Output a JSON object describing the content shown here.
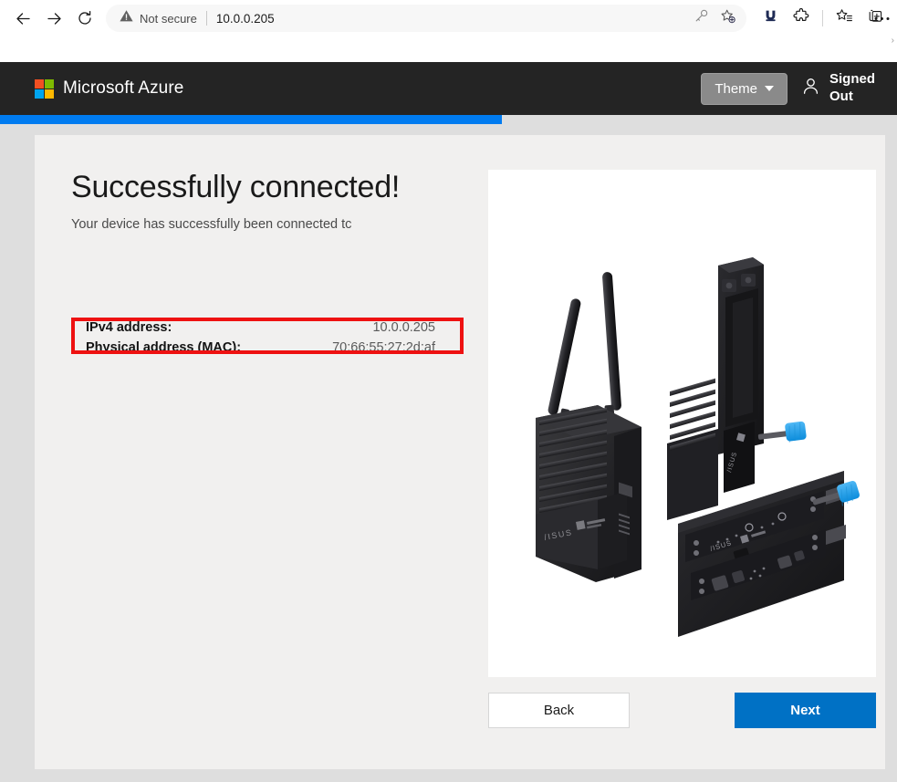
{
  "browser": {
    "back_label": "Back",
    "forward_label": "Forward",
    "refresh_label": "Refresh",
    "security_label": "Not secure",
    "url": "10.0.0.205",
    "icons": {
      "back": "back-arrow-icon",
      "forward": "forward-arrow-icon",
      "refresh": "refresh-icon",
      "warning": "not-secure-warning-icon",
      "password": "key-icon",
      "add_favorite": "star-add-icon",
      "extension_u": "extension-u-icon",
      "puzzle": "extensions-puzzle-icon",
      "favorites": "favorites-list-icon",
      "collections": "collections-icon",
      "overflow": "more-options-icon"
    },
    "overflow_label": "Settings and more"
  },
  "header": {
    "brand": "Microsoft Azure",
    "logo_colors": {
      "top_left": "#f25022",
      "top_right": "#7fba00",
      "bottom_left": "#00a4ef",
      "bottom_right": "#ffb900"
    },
    "theme_button": "Theme",
    "account_status": "Signed Out",
    "account_icon": "person-icon",
    "background": "#242424"
  },
  "progress": {
    "percent": 56,
    "fill_color": "#007bf0",
    "track_color": "#dedede"
  },
  "main": {
    "title": "Successfully connected!",
    "subtitle": "Your device has successfully been connected tc",
    "info": [
      {
        "label": "IPv4 address:",
        "value": "10.0.0.205",
        "highlighted": true
      },
      {
        "label": "Physical address (MAC):",
        "value": "70:66:55:27:2d:af",
        "highlighted": false
      }
    ],
    "highlight_color": "#ee1111",
    "device_image_alt": "ASUS edge device with antennas, heatsink and mounting brackets",
    "buttons": {
      "back": "Back",
      "next": "Next",
      "next_color": "#0071c5"
    }
  }
}
